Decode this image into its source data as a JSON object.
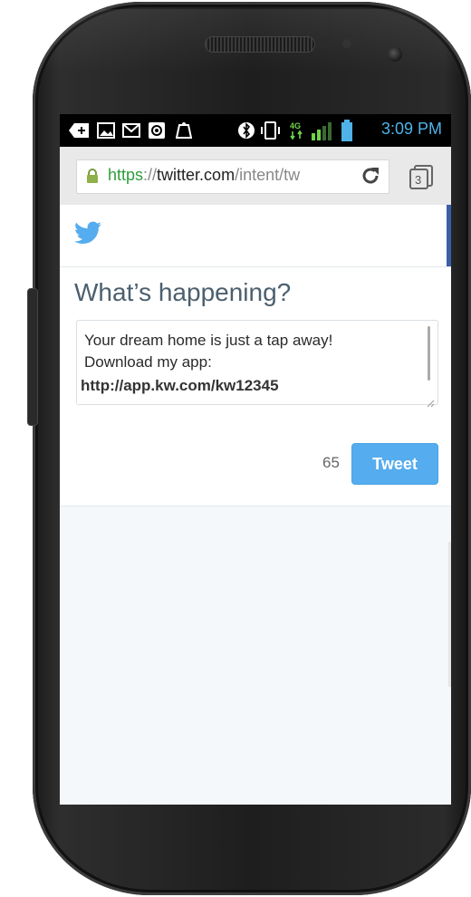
{
  "status_bar": {
    "time": "3:09 PM",
    "icons": [
      "add-notification-icon",
      "image-icon",
      "gmail-icon",
      "at-sign-icon",
      "app-icon",
      "bluetooth-icon",
      "vibrate-icon",
      "4g-data-icon",
      "signal-icon",
      "battery-icon"
    ]
  },
  "browser": {
    "url_scheme": "https",
    "url_separator": "://",
    "url_host": "twitter.com",
    "url_path": "/intent/tw",
    "tab_count": "3"
  },
  "compose": {
    "heading": "What’s happening?",
    "text_line1": "Your dream home is just a tap away!",
    "text_line2": "Download my app:",
    "text_line3": "http://app.kw.com/kw12345",
    "char_count": "65",
    "tweet_label": "Tweet"
  },
  "colors": {
    "twitter_blue": "#55acee",
    "https_green": "#2e9c3c",
    "status_time": "#4fb3e8"
  }
}
